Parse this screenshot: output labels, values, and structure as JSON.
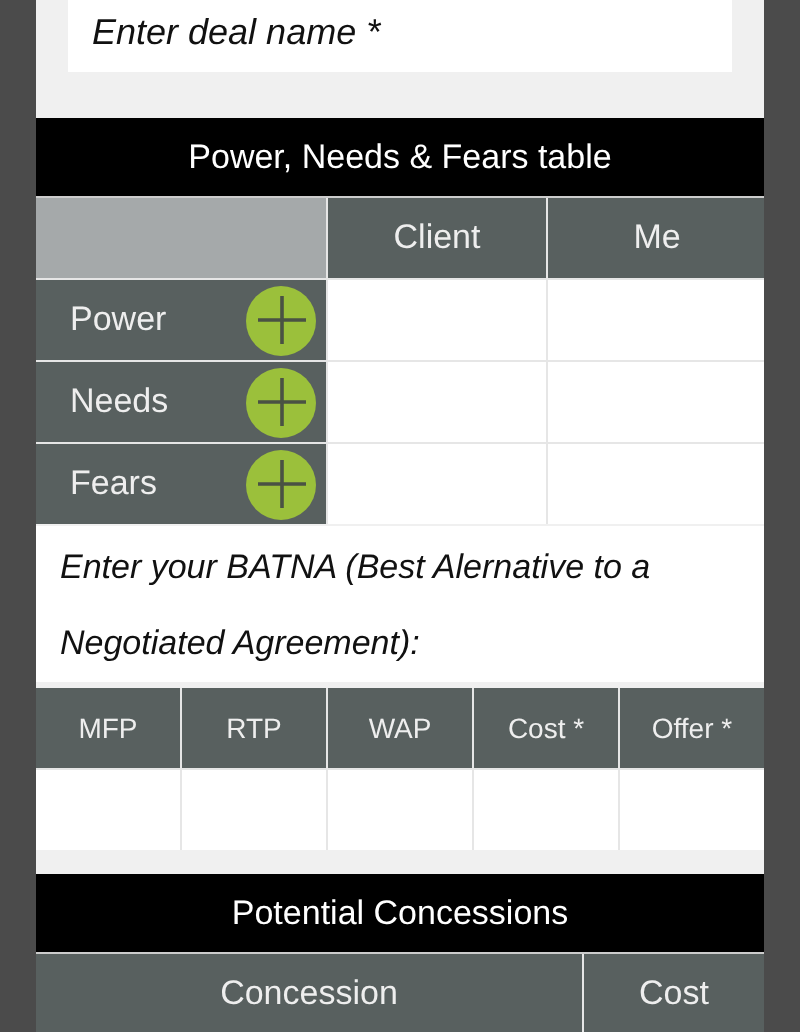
{
  "deal_name": {
    "placeholder": "Enter deal name *"
  },
  "pnf_table": {
    "title": "Power, Needs & Fears table",
    "columns": [
      "Client",
      "Me"
    ],
    "rows": [
      {
        "label": "Power"
      },
      {
        "label": "Needs"
      },
      {
        "label": "Fears"
      }
    ]
  },
  "batna": {
    "placeholder": "Enter your BATNA (Best Alernative to a Negotiated Agreement):"
  },
  "price_table": {
    "columns": [
      "MFP",
      "RTP",
      "WAP",
      "Cost *",
      "Offer *"
    ]
  },
  "concessions": {
    "title": "Potential Concessions",
    "columns": [
      "Concession",
      "Cost"
    ]
  }
}
